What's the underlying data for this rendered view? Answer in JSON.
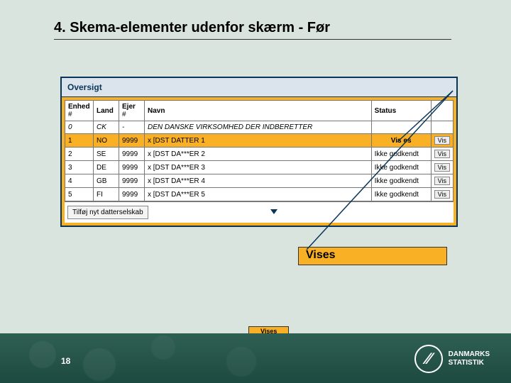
{
  "title": "4. Skema-elementer udenfor skærm - Før",
  "panel": {
    "header": "Oversigt",
    "columns": {
      "enhed": "Enhed",
      "enhed_sub": "#",
      "land": "Land",
      "ejer": "Ejer",
      "ejer_sub": "#",
      "navn": "Navn",
      "status": "Status",
      "action": ""
    },
    "rows": [
      {
        "enhed": "0",
        "land": "CK",
        "ejer": "-",
        "navn": "DEN DANSKE VIRKSOMHED DER INDBERETTER",
        "status": "",
        "highlight": false,
        "btn": ""
      },
      {
        "enhed": "1",
        "land": "NO",
        "ejer": "9999",
        "navn": "x [DST DATTER 1",
        "status": "Vis es",
        "highlight": true,
        "btn": "Vis"
      },
      {
        "enhed": "2",
        "land": "SE",
        "ejer": "9999",
        "navn": "x [DST DA***ER 2",
        "status": "Ikke godkendt",
        "highlight": false,
        "btn": "Vis"
      },
      {
        "enhed": "3",
        "land": "DE",
        "ejer": "9999",
        "navn": "x [DST DA***ER 3",
        "status": "Ikke godkendt",
        "highlight": false,
        "btn": "Vis"
      },
      {
        "enhed": "4",
        "land": "GB",
        "ejer": "9999",
        "navn": "x [DST DA***ER 4",
        "status": "Ikke godkendt",
        "highlight": false,
        "btn": "Vis"
      },
      {
        "enhed": "5",
        "land": "FI",
        "ejer": "9999",
        "navn": "x [DST DA***ER 5",
        "status": "Ikke godkendt",
        "highlight": false,
        "btn": "Vis"
      }
    ],
    "footer_btn": "Tilføj nyt datterselskab"
  },
  "callout_label": "Vises",
  "footer_vises": "Vises",
  "page_number": "18",
  "logo": {
    "line1": "DANMARKS",
    "line2": "STATISTIK",
    "mark": "⁄⁄"
  }
}
